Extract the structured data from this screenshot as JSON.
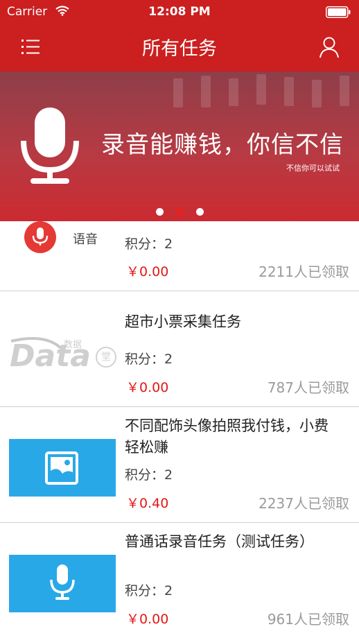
{
  "status_bar": {
    "carrier": "Carrier",
    "time": "12:08 PM"
  },
  "nav": {
    "title": "所有任务",
    "menu_icon": "list-menu-icon",
    "user_icon": "user-icon"
  },
  "banner": {
    "headline": "录音能赚钱，你信不信",
    "subtext": "不信你可以试试",
    "page_count": 3,
    "active_index": 1,
    "colors": {
      "active_dot": "#e52222",
      "dot": "#ffffff"
    }
  },
  "tasks": [
    {
      "title": "",
      "category_label": "语音",
      "points": "积分：2",
      "price": "￥0.00",
      "claimed": "2211人已领取",
      "icon": "microphone-icon"
    },
    {
      "title": "超市小票采集任务",
      "points": "积分：2",
      "price": "￥0.00",
      "claimed": "787人已领取",
      "icon": "data-logo",
      "logo_text": {
        "brand": "Data",
        "cn": "数据",
        "badge": "堂"
      }
    },
    {
      "title": "不同配饰头像拍照我付钱，小费轻松赚",
      "points": "积分：2",
      "price": "￥0.40",
      "claimed": "2237人已领取",
      "icon": "photo-icon"
    },
    {
      "title": "普通话录音任务（测试任务）",
      "points": "积分：2",
      "price": "￥0.00",
      "claimed": "961人已领取",
      "icon": "microphone-icon"
    }
  ],
  "colors": {
    "header": "#cc1f1f",
    "price": "#e41616",
    "thumb": "#29a8e8",
    "count": "#9a9a9a"
  }
}
